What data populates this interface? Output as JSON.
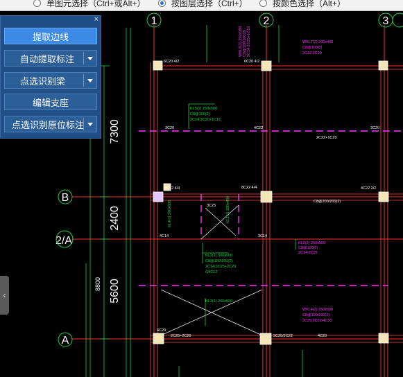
{
  "toolbar": {
    "options": [
      {
        "label": "单图元选择（Ctrl+或Alt+）",
        "selected": false
      },
      {
        "label": "按图层选择（Ctrl+）",
        "selected": true
      },
      {
        "label": "按颜色选择（Alt+）",
        "selected": false
      }
    ]
  },
  "panel": {
    "close_label": "×",
    "buttons": [
      {
        "label": "提取边线",
        "dropdown": false
      },
      {
        "label": "自动提取标注",
        "dropdown": true
      },
      {
        "label": "点选识别梁",
        "dropdown": true
      },
      {
        "label": "编辑支座",
        "dropdown": false
      },
      {
        "label": "点选识别原位标注",
        "dropdown": true
      }
    ]
  },
  "drawing": {
    "axis_columns": [
      "1",
      "2",
      "3"
    ],
    "axis_rows": [
      "B",
      "2/A",
      "A"
    ],
    "dimensions": [
      "7300",
      "2400",
      "5600",
      "8800"
    ],
    "beam_labels": [
      "6C20 4/2",
      "6C20 4/2",
      "8C22 4/4",
      "8C22 4/4",
      "4C22 2/2",
      "WKL8(2) 250x500",
      "C8@100/200(2)",
      "2C14;2C25+1C16",
      "KL5(2) 250x500",
      "C8@100(2)",
      "2C14;2C20+1C16",
      "WKL7(2) 200x400",
      "C8@100(2)",
      "2C22;2C20",
      "KL2(1) 300x600",
      "C8@100/200(2)",
      "2C14;2C25+2C20",
      "G4C12",
      "KL4(1) 200x600",
      "KL3(1) 200x500",
      "KL1(1) 200x400",
      "WKL4(2) 250x600",
      "C8@100/200(2)",
      "2C25;3C22/4C20",
      "KL3(2) 250x500",
      "C8@100(2)",
      "2C14;2C25",
      "C8@200/200(2)",
      "2C22+1C20",
      "3C25",
      "3C25/2C22",
      "4C20",
      "3C20",
      "4C14",
      "3C14",
      "2C20",
      "4C22",
      "4C25",
      "2C25+2C20"
    ]
  }
}
